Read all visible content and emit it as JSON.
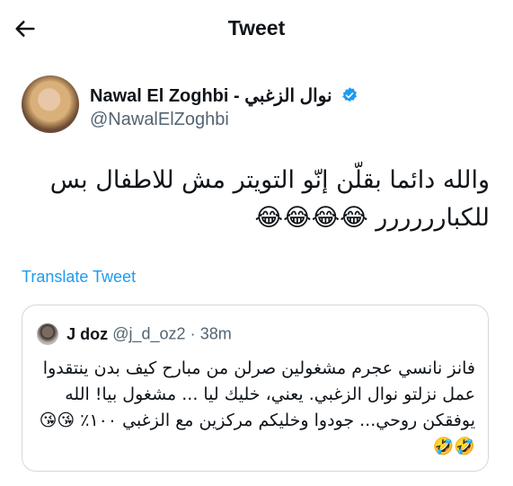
{
  "header": {
    "title": "Tweet",
    "back_icon": "arrow-left-icon"
  },
  "author": {
    "name": "Nawal El Zoghbi - نوال الزغبي",
    "handle": "@NawalElZoghbi",
    "verified_icon": "verified-badge-icon",
    "accent": "#1d9bf0"
  },
  "tweet": {
    "text": "والله دائما بقلّن إنّو التويتر مش للاطفال بس للكبارررررر 😂😂😂😂"
  },
  "translate_label": "Translate Tweet",
  "quote": {
    "name": "J doz",
    "handle": "@j_d_oz2",
    "separator": "·",
    "time": "38m",
    "text": "فانز نانسي عجرم مشغولين صرلن من مبارح كيف بدن ينتقدوا عمل نزلتو نوال الزغبي. يعني، خليك ليا ... مشغول بيا! الله يوفقكن روحي... جودوا وخليكم مركزين مع الزغبي ١٠٠٪ 😘😘🤣🤣"
  }
}
